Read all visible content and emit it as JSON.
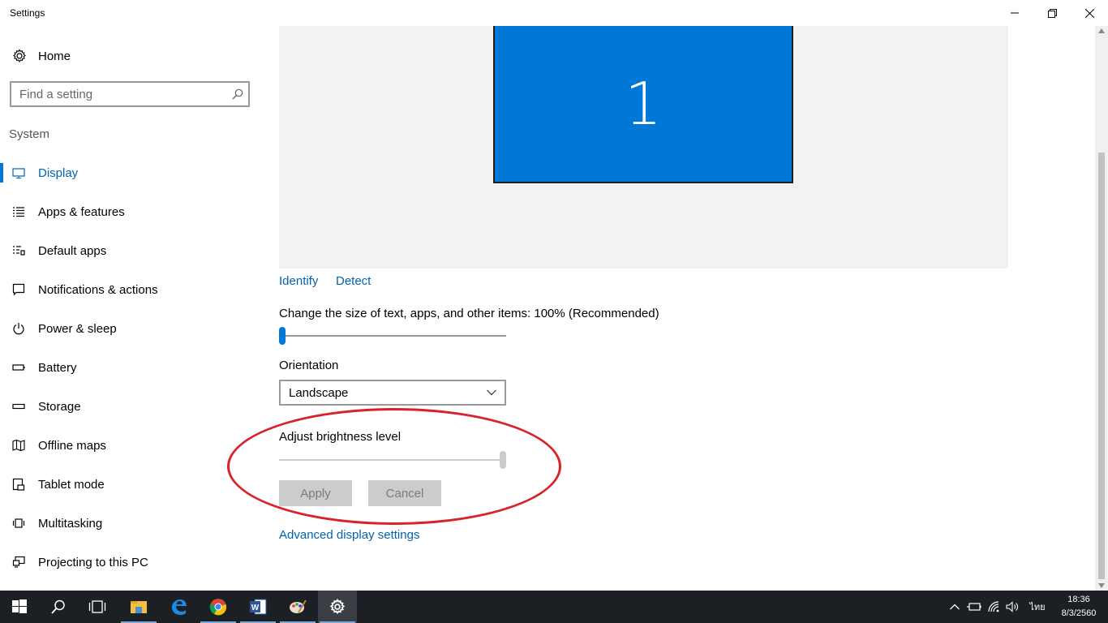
{
  "window": {
    "title": "Settings"
  },
  "sidebar": {
    "home_label": "Home",
    "search_placeholder": "Find a setting",
    "section": "System",
    "items": [
      {
        "label": "Display",
        "icon": "monitor-icon",
        "active": true
      },
      {
        "label": "Apps & features",
        "icon": "list-icon"
      },
      {
        "label": "Default apps",
        "icon": "default-apps-icon"
      },
      {
        "label": "Notifications & actions",
        "icon": "notification-icon"
      },
      {
        "label": "Power & sleep",
        "icon": "power-icon"
      },
      {
        "label": "Battery",
        "icon": "battery-icon"
      },
      {
        "label": "Storage",
        "icon": "storage-icon"
      },
      {
        "label": "Offline maps",
        "icon": "map-icon"
      },
      {
        "label": "Tablet mode",
        "icon": "tablet-icon"
      },
      {
        "label": "Multitasking",
        "icon": "multitasking-icon"
      },
      {
        "label": "Projecting to this PC",
        "icon": "projecting-icon"
      }
    ]
  },
  "display": {
    "monitor_number": "1",
    "identify_label": "Identify",
    "detect_label": "Detect",
    "scale_label": "Change the size of text, apps, and other items: 100% (Recommended)",
    "scale_value": 0,
    "orientation_label": "Orientation",
    "orientation_value": "Landscape",
    "brightness_label": "Adjust brightness level",
    "brightness_value": 1.0,
    "apply_label": "Apply",
    "cancel_label": "Cancel",
    "advanced_label": "Advanced display settings"
  },
  "taskbar": {
    "apps": [
      "start-icon",
      "search-icon",
      "task-view-icon",
      "file-explorer-icon",
      "edge-icon",
      "chrome-icon",
      "word-icon",
      "paint-icon",
      "settings-icon"
    ],
    "language": "ไทย",
    "time": "18:36",
    "date": "8/3/2560"
  },
  "colors": {
    "accent": "#0078d7",
    "link": "#0063b1",
    "highlight_ring": "#d8232a",
    "taskbar": "#1c1f24"
  }
}
